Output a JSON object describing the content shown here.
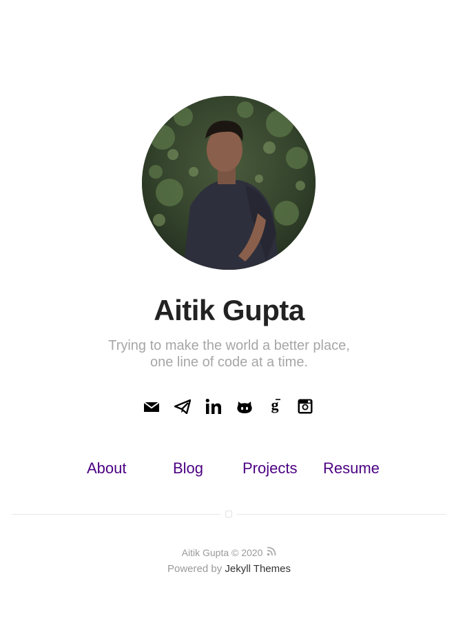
{
  "profile": {
    "name": "Aitik Gupta",
    "tagline_line1": "Trying to make the world a better place,",
    "tagline_line2": "one line of code at a time."
  },
  "socials": [
    {
      "icon": "email-icon"
    },
    {
      "icon": "telegram-icon"
    },
    {
      "icon": "linkedin-icon"
    },
    {
      "icon": "github-icon"
    },
    {
      "icon": "google-scholar-icon"
    },
    {
      "icon": "instagram-icon"
    }
  ],
  "nav": {
    "about": "About",
    "blog": "Blog",
    "projects": "Projects",
    "resume": "Resume"
  },
  "footer": {
    "copyright": "Aitik Gupta © 2020",
    "rss_icon": "rss-icon",
    "powered_by": "Powered by ",
    "theme_link": "Jekyll Themes"
  },
  "colors": {
    "link": "#4b0082",
    "heading": "#222222",
    "muted": "#a6a6a6"
  }
}
